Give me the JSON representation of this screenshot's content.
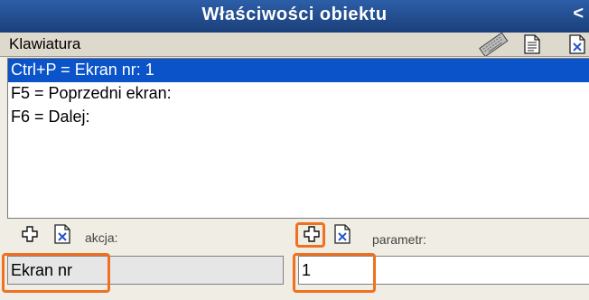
{
  "window": {
    "title": "Właściwości obiektu",
    "collapse_glyph": "<"
  },
  "section": {
    "label": "Klawiatura",
    "icons": [
      "keyboard-icon",
      "document-icon",
      "delete-document-icon"
    ]
  },
  "shortcuts": [
    {
      "text": "Ctrl+P = Ekran nr: 1",
      "selected": true
    },
    {
      "text": "F5 = Poprzedni ekran:",
      "selected": false
    },
    {
      "text": "F6 = Dalej:",
      "selected": false
    }
  ],
  "action": {
    "label": "akcja:",
    "value": "Ekran nr",
    "add_icon": "plus-icon",
    "delete_icon": "delete-document-icon"
  },
  "parameter": {
    "label": "parametr:",
    "value": "1",
    "add_icon": "plus-icon",
    "delete_icon": "delete-document-icon"
  },
  "colors": {
    "title_bar": "#1b3f7a",
    "selection": "#0a53c8",
    "highlight": "#f07020"
  }
}
